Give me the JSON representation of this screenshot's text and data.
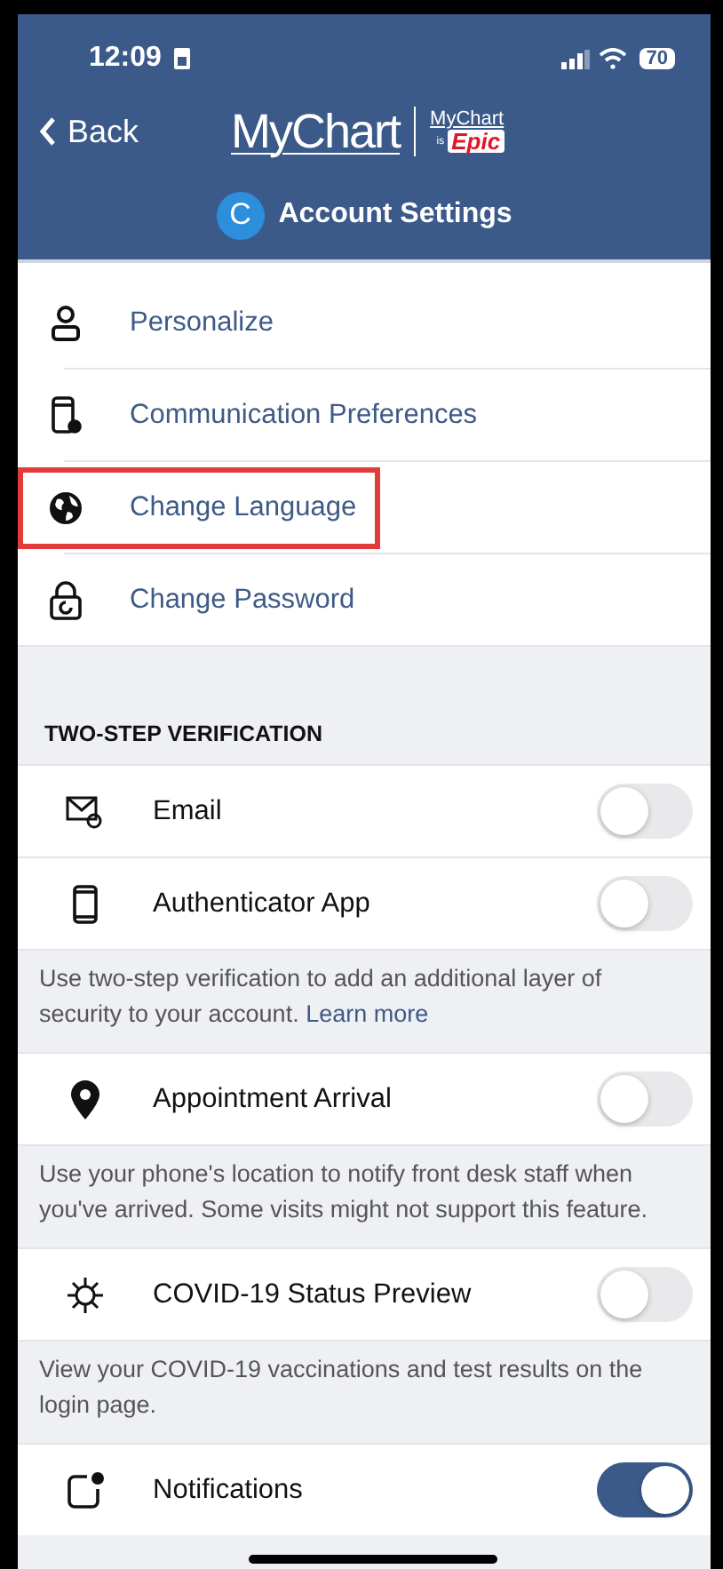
{
  "status_bar": {
    "time": "12:09",
    "battery": "70"
  },
  "header": {
    "back": "Back",
    "logo": "MyChart",
    "badge_top": "MyChart",
    "badge_small": "is",
    "badge_brand": "Epic",
    "avatar": "C",
    "title": "Account Settings"
  },
  "menu": [
    {
      "label": "Personalize",
      "highlighted": false
    },
    {
      "label": "Communication Preferences",
      "highlighted": false
    },
    {
      "label": "Change Language",
      "highlighted": true
    },
    {
      "label": "Change Password",
      "highlighted": false
    }
  ],
  "section_title": "TWO-STEP VERIFICATION",
  "blocks": [
    {
      "kind": "toggle",
      "label": "Email",
      "on": false
    },
    {
      "kind": "toggle",
      "label": "Authenticator App",
      "on": false
    },
    {
      "kind": "note",
      "text": "Use two-step verification to add an additional layer of security to your account.",
      "link": "Learn more"
    },
    {
      "kind": "toggle",
      "label": "Appointment Arrival",
      "on": false
    },
    {
      "kind": "note",
      "text": "Use your phone's location to notify front desk staff when you've arrived. Some visits might not support this feature."
    },
    {
      "kind": "toggle",
      "label": "COVID-19 Status Preview",
      "on": false
    },
    {
      "kind": "note",
      "text": "View your COVID-19 vaccinations and test results on the login page."
    },
    {
      "kind": "toggle",
      "label": "Notifications",
      "on": true
    }
  ]
}
